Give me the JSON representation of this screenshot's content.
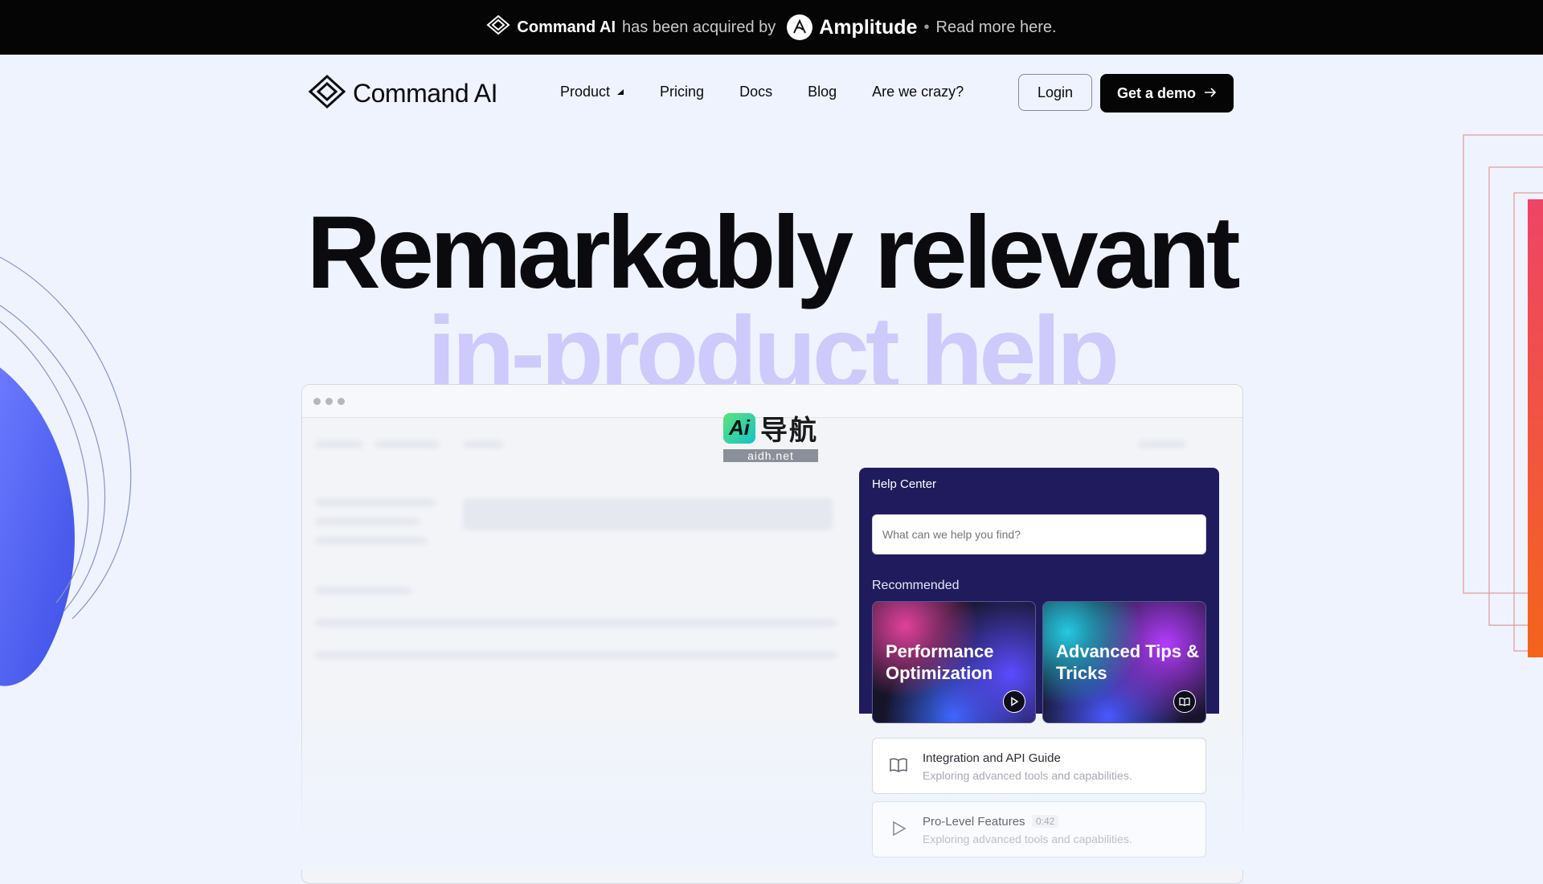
{
  "announcement": {
    "brand": "Command AI",
    "text": "has been acquired by",
    "acquirer": "Amplitude",
    "separator": "•",
    "link": "Read more here."
  },
  "nav": {
    "logo_text": "Command AI",
    "items": [
      {
        "label": "Product"
      },
      {
        "label": "Pricing"
      },
      {
        "label": "Docs"
      },
      {
        "label": "Blog"
      },
      {
        "label": "Are we crazy?"
      }
    ],
    "login_label": "Login",
    "demo_label": "Get a demo"
  },
  "hero": {
    "title": "Remarkably relevant",
    "subtitle": "in-product help"
  },
  "watermark": {
    "badge": "Ai",
    "text": "导航",
    "url": "aidh.net"
  },
  "help_center": {
    "title": "Help Center",
    "search_placeholder": "What can we help you find?",
    "recommended_label": "Recommended",
    "cards": [
      {
        "title": "Performance Optimization",
        "icon": "play-icon"
      },
      {
        "title": "Advanced Tips & Tricks",
        "icon": "book-icon"
      }
    ],
    "list": [
      {
        "title": "Integration and API Guide",
        "desc": "Exploring advanced tools and capabilities.",
        "icon": "book-icon"
      },
      {
        "title": "Pro-Level Features",
        "badge": "0:42",
        "desc": "Exploring advanced tools and capabilities.",
        "icon": "play-icon"
      }
    ]
  },
  "colors": {
    "background": "#eef3fd",
    "topbar": "#050505",
    "help_header": "#201b5c",
    "hero_sub": "#c9c3fb",
    "accent_blue": "#4b5cf0",
    "accent_orange": "#f4641c"
  }
}
